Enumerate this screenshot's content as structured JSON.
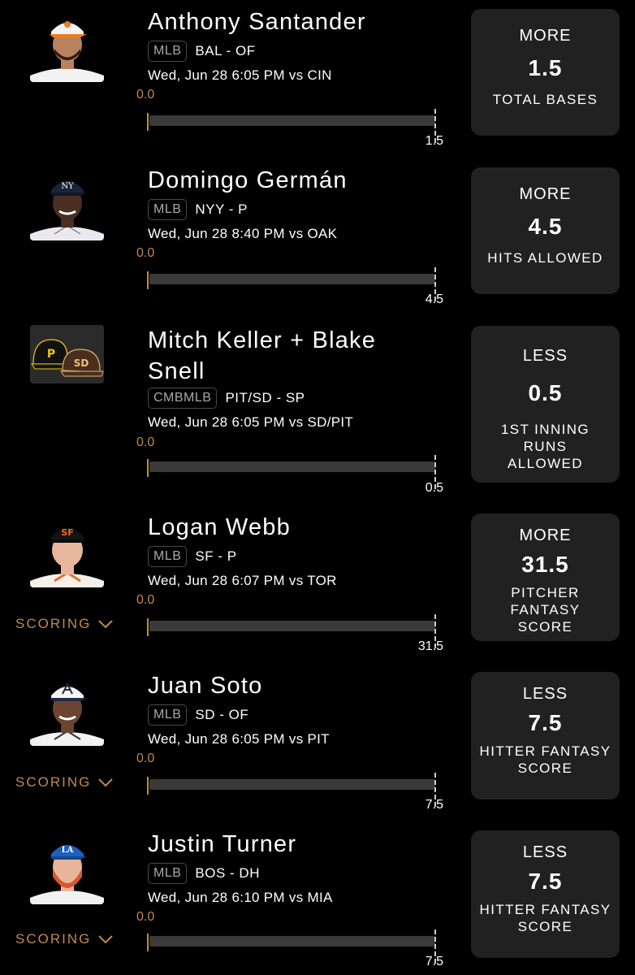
{
  "colors": {
    "accent": "#c08a4c",
    "card_bg": "#212121",
    "bar_bg": "#3a3a3a",
    "background": "#000000"
  },
  "picks": [
    {
      "player": "Anthony Santander",
      "league": "MLB",
      "team_pos": "BAL - OF",
      "game": "Wed, Jun 28 6:05 PM  vs CIN",
      "current": "0.0",
      "line": "1.5",
      "progress": 0,
      "direction": "MORE",
      "value": "1.5",
      "stat": "TOTAL BASES",
      "scoring": null,
      "avatar": "player-headshot-orioles"
    },
    {
      "player": "Domingo Germán",
      "league": "MLB",
      "team_pos": "NYY - P",
      "game": "Wed, Jun 28 8:40 PM  vs OAK",
      "current": "0.0",
      "line": "4.5",
      "progress": 0,
      "direction": "MORE",
      "value": "4.5",
      "stat": "HITS ALLOWED",
      "scoring": null,
      "avatar": "player-headshot-yankees"
    },
    {
      "player": "Mitch Keller + Blake Snell",
      "league": "CMBMLB",
      "team_pos": "PIT/SD - SP",
      "game": "Wed, Jun 28 6:05 PM  vs SD/PIT",
      "current": "0.0",
      "line": "0.5",
      "progress": 0,
      "direction": "LESS",
      "value": "0.5",
      "stat": "1ST INNING RUNS ALLOWED",
      "scoring": null,
      "avatar": "team-caps-pit-sd"
    },
    {
      "player": "Logan Webb",
      "league": "MLB",
      "team_pos": "SF - P",
      "game": "Wed, Jun 28 6:07 PM  vs TOR",
      "current": "0.0",
      "line": "31.5",
      "progress": 0,
      "direction": "MORE",
      "value": "31.5",
      "stat": "PITCHER FANTASY SCORE",
      "scoring": "SCORING",
      "avatar": "player-headshot-giants"
    },
    {
      "player": "Juan Soto",
      "league": "MLB",
      "team_pos": "SD - OF",
      "game": "Wed, Jun 28 6:05 PM  vs PIT",
      "current": "0.0",
      "line": "7.5",
      "progress": 0,
      "direction": "LESS",
      "value": "7.5",
      "stat": "HITTER FANTASY SCORE",
      "scoring": "SCORING",
      "avatar": "player-headshot-allstar"
    },
    {
      "player": "Justin Turner",
      "league": "MLB",
      "team_pos": "BOS - DH",
      "game": "Wed, Jun 28 6:10 PM  vs MIA",
      "current": "0.0",
      "line": "7.5",
      "progress": 0,
      "direction": "LESS",
      "value": "7.5",
      "stat": "HITTER FANTASY SCORE",
      "scoring": "SCORING",
      "avatar": "player-headshot-dodgers"
    }
  ]
}
